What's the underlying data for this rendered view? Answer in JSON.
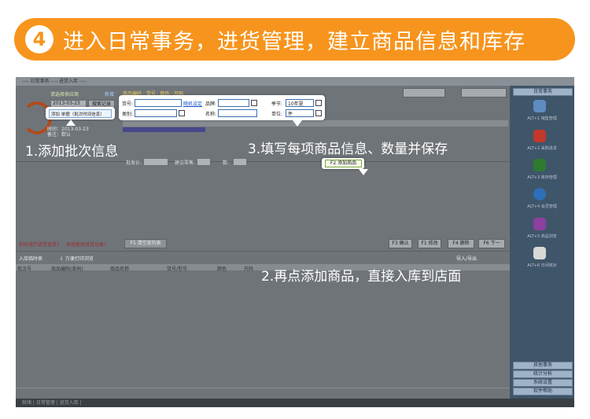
{
  "banner": {
    "step_number": "4",
    "title": "进入日常事务，进货管理，建立商品信息和库存"
  },
  "window": {
    "title_text": "---- 日常事务 ---- 进货入库 ----",
    "status_text": "就绪 | 日常管理 | 进货入库 |",
    "status_right": ""
  },
  "top_panel": {
    "supplier_label": "请选择供应商",
    "supplier_link": "新增",
    "date_value": "2013-03-23",
    "query_button": "搜索记录",
    "add_batch_button": "添加 单据（批次时间信息）",
    "batch_info_1": "时间：2013-03-23",
    "batch_info_2": "备注：默认",
    "sub_heading": "商品编码 · 货号 · 颜色 · 尺码"
  },
  "product_form": {
    "item_no_label": "货号:",
    "auto_gen_link": "随机设定",
    "brand_label": "品牌:",
    "season_label": "季节:",
    "season_value": "10年夏",
    "category_label": "类别:",
    "name_label": "名称:",
    "unit_label": "单位:",
    "unit_value": "件",
    "price_label": "批发价:",
    "retail_label": "建议零售:",
    "qty_label": "数:"
  },
  "bottom_panel": {
    "red_text_1": "如何进行进货退货?",
    "red_text_2": "如何查找进货记录?",
    "clear_button": "F5 清空现列表",
    "add_product_button": "F2 添加商品",
    "confirm_button": "F3 确认",
    "edit_button": "F1 修改",
    "delete_button": "F4 删除",
    "next_button": "F6 下一",
    "records_title": "入库临时表",
    "print_title": "⇩ 方便打印浏览",
    "columns": [
      "批次号",
      "商品编码(条码)",
      "商品名称",
      "货号/型号",
      "颜色",
      "尺码"
    ],
    "import_export": "导入/导出"
  },
  "sidebar": {
    "top_button": "日常事务",
    "items": [
      {
        "icon": "shop-icon",
        "label": "ALT+1 销售管理"
      },
      {
        "icon": "box-icon",
        "label": "ALT+2 采购进货"
      },
      {
        "icon": "pen-icon",
        "label": "ALT+3 库存管理"
      },
      {
        "icon": "member-icon",
        "label": "ALT+4 会员管理"
      },
      {
        "icon": "fruit-icon",
        "label": "ALT+5 商品浏览"
      },
      {
        "icon": "bag-icon",
        "label": "ALT+6 日间核对"
      }
    ],
    "bottom_buttons": [
      "其他事务",
      "统计分析",
      "系统设置",
      "软件帮助"
    ]
  },
  "annotations": {
    "note_1": "1.添加批次信息",
    "note_2": "2.再点添加商品，直接入库到店面",
    "note_3": "3.填写每项商品信息、数量并保存"
  },
  "colors": {
    "banner": "#f7941d",
    "app_bg": "#6f7479",
    "sidebar": "#3f5569"
  }
}
